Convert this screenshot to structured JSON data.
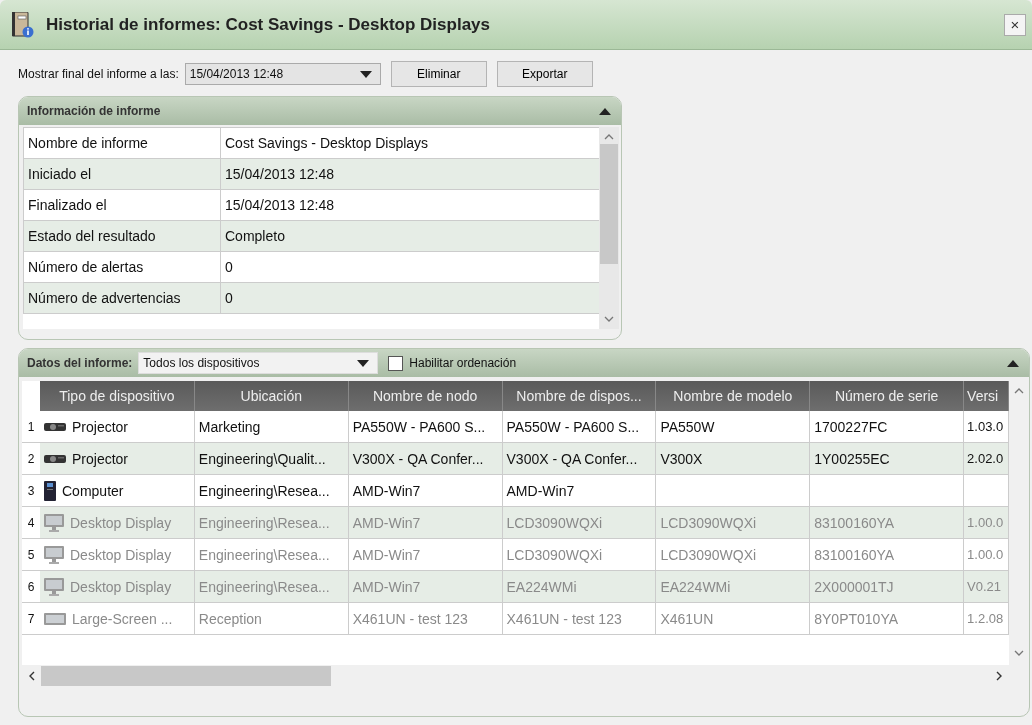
{
  "window": {
    "title": "Historial de informes: Cost Savings - Desktop Displays",
    "close": "×"
  },
  "toolbar": {
    "label": "Mostrar final del informe a las:",
    "date_select": "15/04/2013 12:48",
    "buttons": [
      "Eliminar",
      "Exportar"
    ]
  },
  "info_panel": {
    "title": "Información de informe",
    "expanded": true,
    "rows": [
      {
        "label": "Nombre de informe",
        "value": "Cost Savings - Desktop Displays"
      },
      {
        "label": "Iniciado el",
        "value": "15/04/2013 12:48"
      },
      {
        "label": "Finalizado el",
        "value": "15/04/2013 12:48"
      },
      {
        "label": "Estado del resultado",
        "value": "Completo"
      },
      {
        "label": "Número de alertas",
        "value": "0"
      },
      {
        "label": "Número de advertencias",
        "value": "0"
      }
    ]
  },
  "data_panel": {
    "label": "Datos del informe:",
    "filter": "Todos los dispositivos",
    "sort_checkbox": {
      "label": "Habilitar ordenación",
      "checked": false
    },
    "expanded": true,
    "table": {
      "columns": [
        "Tipo de dispositivo",
        "Ubicación",
        "Nombre de nodo",
        "Nombre de dispos...",
        "Nombre de modelo",
        "Número de serie",
        "Versi"
      ],
      "rows": [
        {
          "number": "1",
          "kind": "projector",
          "disabled": false,
          "cells": [
            "Projector",
            "Marketing",
            "PA550W - PA600 S...",
            "PA550W - PA600 S...",
            "PA550W",
            "1700227FC",
            "1.03.0"
          ]
        },
        {
          "number": "2",
          "kind": "projector",
          "disabled": false,
          "cells": [
            "Projector",
            "Engineering\\Qualit...",
            "V300X - QA Confer...",
            "V300X - QA Confer...",
            "V300X",
            "1Y00255EC",
            "2.02.0"
          ]
        },
        {
          "number": "3",
          "kind": "computer",
          "disabled": false,
          "cells": [
            "Computer",
            "Engineering\\Resea...",
            "AMD-Win7",
            "AMD-Win7",
            "",
            "",
            ""
          ]
        },
        {
          "number": "4",
          "kind": "display",
          "disabled": true,
          "cells": [
            "Desktop Display",
            "Engineering\\Resea...",
            "AMD-Win7",
            "LCD3090WQXi",
            "LCD3090WQXi",
            "83100160YA",
            "1.00.0"
          ]
        },
        {
          "number": "5",
          "kind": "display",
          "disabled": true,
          "cells": [
            "Desktop Display",
            "Engineering\\Resea...",
            "AMD-Win7",
            "LCD3090WQXi",
            "LCD3090WQXi",
            "83100160YA",
            "1.00.0"
          ]
        },
        {
          "number": "6",
          "kind": "display",
          "disabled": true,
          "cells": [
            "Desktop Display",
            "Engineering\\Resea...",
            "AMD-Win7",
            "EA224WMi",
            "EA224WMi",
            "2X000001TJ",
            "V0.21"
          ]
        },
        {
          "number": "7",
          "kind": "large_screen",
          "disabled": true,
          "cells": [
            "Large-Screen ...",
            "Reception",
            "X461UN - test 123",
            "X461UN - test 123",
            "X461UN",
            "8Y0PT010YA",
            "1.2.08"
          ]
        }
      ]
    }
  }
}
